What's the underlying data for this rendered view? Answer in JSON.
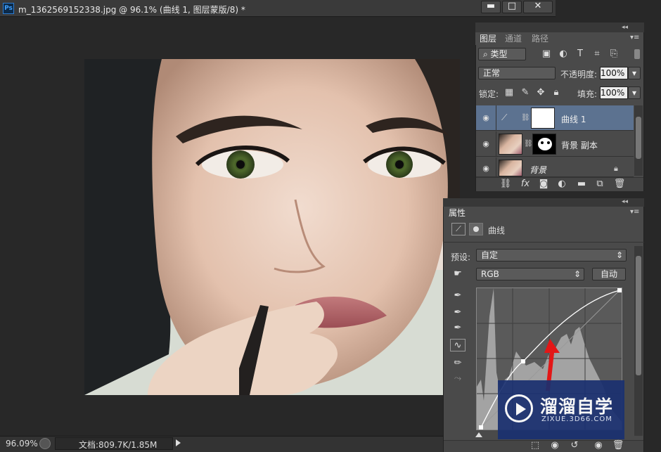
{
  "document": {
    "title": "m_1362569152338.jpg @ 96.1% (曲线 1, 图层蒙版/8) *",
    "ps_logo": "Ps",
    "zoom": "96.09%",
    "doc_info": "文档:809.7K/1.85M"
  },
  "window_buttons": [
    "▬",
    "□",
    "✕"
  ],
  "layers_panel": {
    "tabs": [
      "图层",
      "通道",
      "路径"
    ],
    "filter_label": "类型",
    "blend_mode": "正常",
    "opacity_label": "不透明度:",
    "opacity_value": "100%",
    "lock_label": "锁定:",
    "fill_label": "填充:",
    "fill_value": "100%",
    "layers": [
      {
        "name": "曲线 1",
        "selected": true
      },
      {
        "name": "背景 副本",
        "selected": false
      },
      {
        "name": "背景",
        "selected": false,
        "italic": true
      }
    ]
  },
  "properties_panel": {
    "tab": "属性",
    "title": "曲线",
    "preset_label": "预设:",
    "preset_value": "自定",
    "channel_value": "RGB",
    "auto_button": "自动"
  },
  "watermark": {
    "brand": "溜溜自学",
    "url": "ZIXUE.3D66.COM"
  },
  "colors": {
    "selected_layer": "#5c7290",
    "panel_bg": "#4a4a4a",
    "watermark_bg": "#1a3070",
    "arrow_red": "#e31616"
  }
}
